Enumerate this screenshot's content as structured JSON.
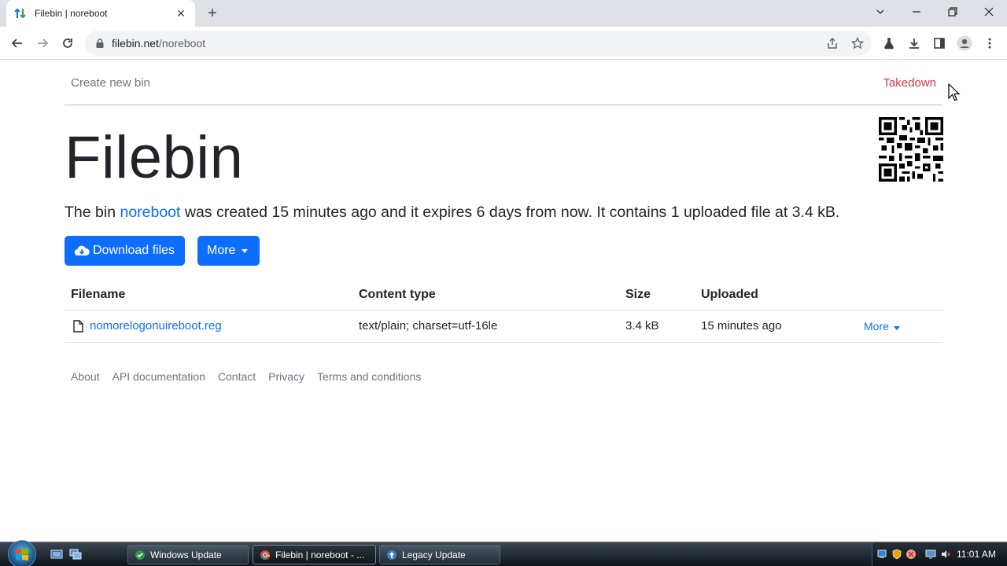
{
  "browser": {
    "tab_title": "Filebin | noreboot",
    "new_tab": "+",
    "url_host": "filebin.net",
    "url_path": "/noreboot"
  },
  "nav": {
    "create": "Create new bin",
    "takedown": "Takedown"
  },
  "main": {
    "title": "Filebin",
    "lead_prefix": "The bin ",
    "bin_name": "noreboot",
    "lead_suffix": " was created 15 minutes ago and it expires 6 days from now. It contains 1 uploaded file at 3.4 kB.",
    "download_label": "Download files",
    "more_label": "More"
  },
  "table": {
    "headers": [
      "Filename",
      "Content type",
      "Size",
      "Uploaded"
    ],
    "rows": [
      {
        "filename": "nomorelogonuireboot.reg",
        "content_type": "text/plain; charset=utf-16le",
        "size": "3.4 kB",
        "uploaded": "15 minutes ago",
        "more": "More"
      }
    ]
  },
  "footer": [
    "About",
    "API documentation",
    "Contact",
    "Privacy",
    "Terms and conditions"
  ],
  "taskbar": {
    "items": [
      "Windows Update",
      "Filebin | noreboot - ...",
      "Legacy Update"
    ],
    "clock": "11:01 AM"
  },
  "colors": {
    "primary": "#0d6efd",
    "danger": "#dc3545",
    "muted": "#6c757d"
  },
  "icons": {
    "tab_favicon": "filebin-arrows-icon",
    "lock": "lock-icon",
    "download": "cloud-download-icon",
    "file": "file-icon"
  }
}
